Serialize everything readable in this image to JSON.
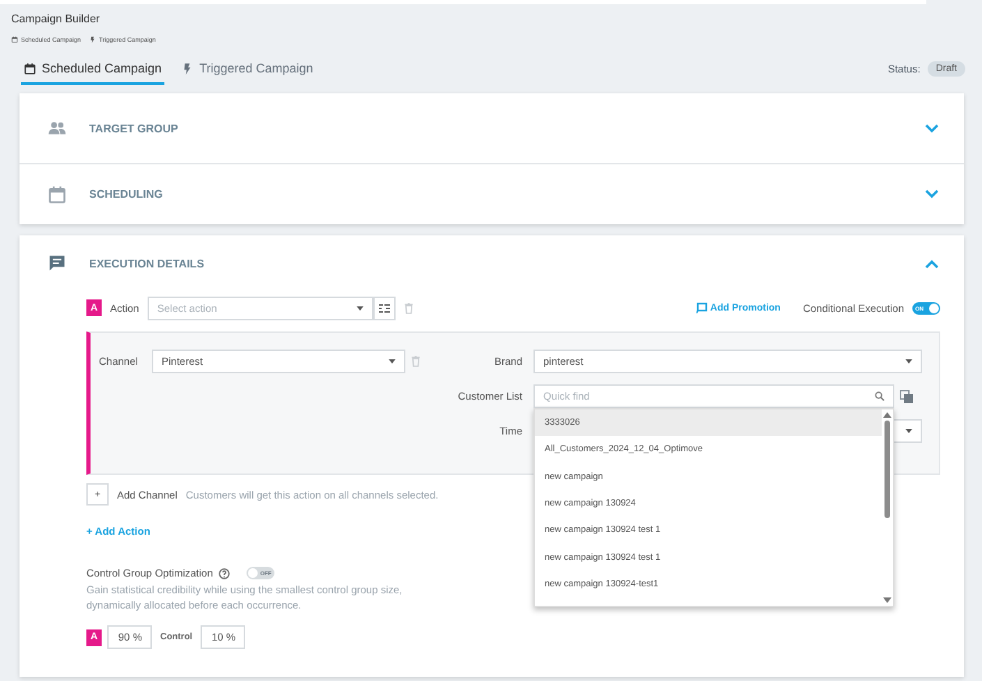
{
  "header": {
    "title": "Campaign Builder",
    "breadcrumbs": [
      {
        "label": "Scheduled Campaign"
      },
      {
        "label": "Triggered Campaign"
      }
    ]
  },
  "tabs": [
    {
      "label": "Scheduled Campaign",
      "selected": true
    },
    {
      "label": "Triggered Campaign",
      "selected": false
    }
  ],
  "status": {
    "label": "Status:",
    "value": "Draft"
  },
  "sections": [
    {
      "title": "TARGET GROUP",
      "expanded": false
    },
    {
      "title": "SCHEDULING",
      "expanded": false
    }
  ],
  "execution": {
    "title": "EXECUTION DETAILS",
    "expanded": true,
    "action": {
      "badge": "A",
      "label": "Action",
      "placeholder": "Select action"
    },
    "add_promotion": "Add Promotion",
    "conditional_execution": {
      "label": "Conditional Execution",
      "on": true,
      "text": "ON"
    },
    "channel": {
      "label": "Channel",
      "value": "Pinterest"
    },
    "brand": {
      "label": "Brand",
      "value": "pinterest"
    },
    "customer_list": {
      "label": "Customer List",
      "placeholder": "Quick find",
      "options": [
        {
          "label": "3333026",
          "selected": true
        },
        {
          "label": "All_Customers_2024_12_04_Optimove",
          "selected": false
        },
        {
          "label": "new campaign",
          "selected": false
        },
        {
          "label": "new campaign 130924",
          "selected": false
        },
        {
          "label": "new campaign 130924 test 1",
          "selected": false
        },
        {
          "label": "new campaign 130924 test 1",
          "selected": false
        },
        {
          "label": "new campaign 130924-test1",
          "selected": false
        }
      ]
    },
    "time": {
      "label": "Time"
    },
    "add_channel": {
      "button": "+",
      "label": "Add Channel",
      "note": "Customers will get this action on all channels selected."
    },
    "add_action": "+ Add Action",
    "control_group": {
      "label": "Control Group Optimization",
      "on": false,
      "text": "OFF",
      "description": "Gain statistical credibility while using the smallest control group size, dynamically allocated before each occurrence."
    },
    "split": {
      "badge": "A",
      "value": "90 %",
      "control_label": "Control",
      "control_value": "10 %"
    }
  }
}
